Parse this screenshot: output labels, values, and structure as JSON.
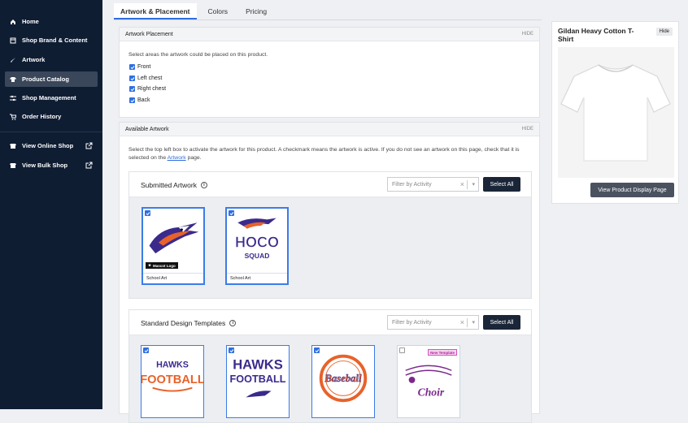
{
  "sidebar": {
    "items": [
      {
        "label": "Home",
        "icon": "home-icon"
      },
      {
        "label": "Shop Brand & Content",
        "icon": "layout-icon"
      },
      {
        "label": "Artwork",
        "icon": "brush-icon"
      },
      {
        "label": "Product Catalog",
        "icon": "shirt-icon"
      },
      {
        "label": "Shop Management",
        "icon": "sliders-icon"
      },
      {
        "label": "Order History",
        "icon": "cart-icon"
      },
      {
        "label": "View Online Shop",
        "icon": "store-icon"
      },
      {
        "label": "View Bulk Shop",
        "icon": "store-icon"
      }
    ]
  },
  "tabs": [
    "Artwork & Placement",
    "Colors",
    "Pricing"
  ],
  "placement": {
    "title": "Artwork Placement",
    "hide": "HIDE",
    "instruction": "Select areas the artwork could be placed on this product.",
    "options": [
      "Front",
      "Left chest",
      "Right chest",
      "Back"
    ]
  },
  "available": {
    "title": "Available Artwork",
    "hide": "HIDE",
    "instruction_a": "Select the top left box to activate the artwork for this product. A checkmark means the artwork is active. If you do not see an artwork on this page, check that it is selected on the",
    "instruction_link": "Artwork",
    "instruction_b": "page."
  },
  "submitted": {
    "title": "Submitted Artwork",
    "filter_placeholder": "Filter by Activity",
    "select_all": "Select All",
    "cards": [
      {
        "label": "School Art",
        "badge": "Mascot Logo"
      },
      {
        "label": "School Art",
        "art_line1": "HOCO",
        "art_line2": "SQUAD"
      }
    ]
  },
  "templates": {
    "title": "Standard Design Templates",
    "filter_placeholder": "Filter by Activity",
    "select_all": "Select All",
    "cards": [
      {
        "line1": "HAWKS",
        "line2": "FOOTBALL"
      },
      {
        "line1": "HAWKS",
        "line2": "FOOTBALL"
      },
      {
        "line1": "Baseball"
      },
      {
        "line1": "Choir",
        "badge": "New Template"
      }
    ]
  },
  "product": {
    "title": "Gildan Heavy Cotton T-Shirt",
    "hide": "Hide",
    "button": "View Product Display Page"
  },
  "colors": {
    "accent": "#2f6fe0",
    "sidebar": "#0f1d33",
    "purple": "#3b2a8c",
    "orange": "#e8622a"
  }
}
